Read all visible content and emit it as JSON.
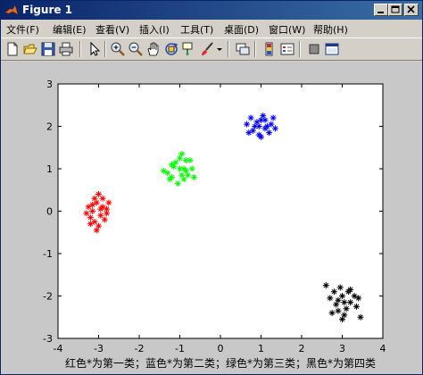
{
  "window": {
    "title": "Figure 1"
  },
  "menu": [
    {
      "label": "文件(F)"
    },
    {
      "label": "编辑(E)"
    },
    {
      "label": "查看(V)"
    },
    {
      "label": "插入(I)"
    },
    {
      "label": "工具(T)"
    },
    {
      "label": "桌面(D)"
    },
    {
      "label": "窗口(W)"
    },
    {
      "label": "帮助(H)"
    }
  ],
  "toolbar_icons": [
    "new-figure-icon",
    "open-file-icon",
    "save-icon",
    "print-icon",
    "edit-plot-arrow-icon",
    "zoom-in-icon",
    "zoom-out-icon",
    "pan-hand-icon",
    "rotate-3d-icon",
    "data-cursor-icon",
    "brush-icon",
    "link-plot-icon",
    "colorbar-icon",
    "legend-icon",
    "hide-plot-tools-icon",
    "show-plot-tools-icon"
  ],
  "chart_data": {
    "type": "scatter",
    "xlim": [
      -4,
      4
    ],
    "ylim": [
      -3,
      3
    ],
    "x_ticks": [
      "-4",
      "-3",
      "-2",
      "-1",
      "0",
      "1",
      "2",
      "3",
      "4"
    ],
    "y_ticks": [
      "-3",
      "-2",
      "-1",
      "0",
      "1",
      "2",
      "3"
    ],
    "xlabel": "红色*为第一类；蓝色*为第二类；绿色*为第三类；黑色*为第四类",
    "marker": "*",
    "grid": false,
    "series": [
      {
        "color": "#ff0000",
        "points": [
          [
            -3.15,
            0.0
          ],
          [
            -3.05,
            0.2
          ],
          [
            -2.9,
            0.1
          ],
          [
            -3.2,
            -0.15
          ],
          [
            -3.0,
            -0.35
          ],
          [
            -2.8,
            0.05
          ],
          [
            -3.1,
            0.3
          ],
          [
            -2.95,
            -0.1
          ],
          [
            -3.25,
            0.1
          ],
          [
            -2.85,
            -0.2
          ],
          [
            -3.0,
            0.4
          ],
          [
            -3.1,
            -0.25
          ],
          [
            -2.75,
            0.2
          ],
          [
            -3.3,
            -0.05
          ],
          [
            -3.05,
            -0.45
          ],
          [
            -2.9,
            0.3
          ],
          [
            -3.15,
            0.15
          ],
          [
            -2.95,
            0.05
          ],
          [
            -3.2,
            -0.3
          ],
          [
            -2.8,
            -0.05
          ]
        ]
      },
      {
        "color": "#0000ff",
        "points": [
          [
            0.85,
            2.0
          ],
          [
            1.0,
            2.15
          ],
          [
            1.1,
            1.95
          ],
          [
            0.7,
            1.85
          ],
          [
            1.25,
            2.05
          ],
          [
            0.95,
            1.8
          ],
          [
            1.05,
            2.25
          ],
          [
            0.65,
            2.05
          ],
          [
            1.2,
            1.85
          ],
          [
            1.3,
            2.2
          ],
          [
            0.9,
            2.1
          ],
          [
            1.15,
            2.0
          ],
          [
            0.8,
            1.9
          ],
          [
            1.0,
            1.75
          ],
          [
            1.35,
            1.95
          ],
          [
            0.75,
            2.2
          ],
          [
            1.1,
            2.15
          ],
          [
            0.95,
            2.0
          ]
        ]
      },
      {
        "color": "#00ff00",
        "points": [
          [
            -1.0,
            1.0
          ],
          [
            -0.85,
            1.2
          ],
          [
            -1.2,
            0.8
          ],
          [
            -0.9,
            0.75
          ],
          [
            -1.1,
            1.15
          ],
          [
            -0.7,
            1.0
          ],
          [
            -1.3,
            0.9
          ],
          [
            -0.95,
            1.35
          ],
          [
            -0.8,
            0.85
          ],
          [
            -1.05,
            0.65
          ],
          [
            -1.4,
            0.95
          ],
          [
            -0.75,
            1.2
          ],
          [
            -1.15,
            1.05
          ],
          [
            -0.9,
            1.0
          ],
          [
            -1.25,
            0.75
          ],
          [
            -0.65,
            0.8
          ],
          [
            -1.0,
            1.25
          ],
          [
            -0.85,
            0.95
          ],
          [
            -1.2,
            1.1
          ],
          [
            -0.95,
            0.85
          ]
        ]
      },
      {
        "color": "#000000",
        "points": [
          [
            3.0,
            -2.0
          ],
          [
            2.85,
            -2.2
          ],
          [
            3.15,
            -1.9
          ],
          [
            2.9,
            -2.35
          ],
          [
            3.2,
            -2.15
          ],
          [
            2.7,
            -2.05
          ],
          [
            3.05,
            -2.45
          ],
          [
            3.3,
            -2.0
          ],
          [
            2.95,
            -1.8
          ],
          [
            3.1,
            -2.3
          ],
          [
            2.8,
            -1.9
          ],
          [
            3.35,
            -2.25
          ],
          [
            2.6,
            -1.75
          ],
          [
            3.0,
            -2.55
          ],
          [
            3.45,
            -2.5
          ],
          [
            2.9,
            -2.1
          ],
          [
            3.2,
            -1.85
          ],
          [
            3.4,
            -2.05
          ],
          [
            2.75,
            -2.4
          ],
          [
            3.05,
            -2.15
          ]
        ]
      }
    ]
  }
}
